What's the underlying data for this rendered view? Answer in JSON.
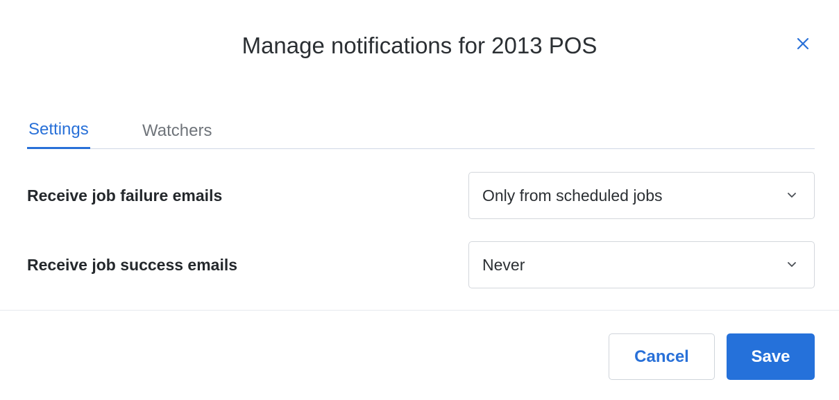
{
  "dialog": {
    "title": "Manage notifications for 2013 POS",
    "close_icon": "close-icon"
  },
  "tabs": [
    {
      "label": "Settings",
      "active": true
    },
    {
      "label": "Watchers",
      "active": false
    }
  ],
  "settings": {
    "failure": {
      "label": "Receive job failure emails",
      "value": "Only from scheduled jobs",
      "icon": "chevron-down-icon"
    },
    "success": {
      "label": "Receive job success emails",
      "value": "Never",
      "icon": "chevron-down-icon"
    }
  },
  "footer": {
    "cancel_label": "Cancel",
    "save_label": "Save"
  },
  "colors": {
    "accent": "#2870d8",
    "save_bg": "#2571da",
    "text": "#2b2f33",
    "muted": "#6f747a"
  }
}
